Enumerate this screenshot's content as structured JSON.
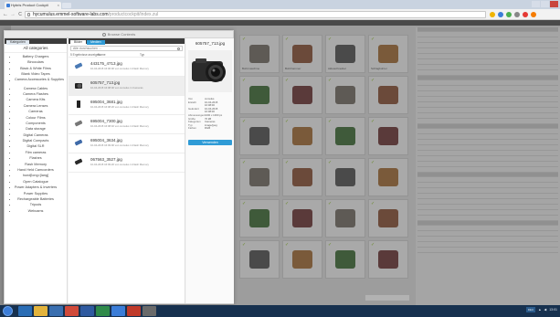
{
  "browser": {
    "tab_title": "Hybris Product Cockpit",
    "tab_close": "×",
    "url_host": "hycumulus.emmel-software-labs.com",
    "url_path": "/productcockpit/index.zul",
    "nav_back": "←",
    "nav_forward": "→",
    "nav_reload": "C"
  },
  "modal": {
    "title": "Browse Contents",
    "categories": {
      "tab_label": "Kategorien",
      "heading": "All categories",
      "items": [
        "Battery Chargers",
        "Binoculars",
        "Black & White Films",
        "Blank Video Tapes",
        "Camera Accessories & Supplies",
        "Camera Cables",
        "Camera Flashes",
        "Camera Kits",
        "Camera Lenses",
        "Cameras",
        "Colour Films",
        "Components",
        "Data storage",
        "Digital Cameras",
        "Digital Compacts",
        "Digital SLR",
        "Film cameras",
        "Flashes",
        "Flash Memory",
        "Hand Held Camcorders",
        "hund[long=]lang]",
        "Open Catalogue",
        "Power Adapters & Inverters",
        "Power Supplies",
        "Rechargeable Batteries",
        "Tripods",
        "Webcams"
      ]
    },
    "files": {
      "tab_active": "Bilder",
      "tab_inactive": "Medien",
      "search_placeholder": "Alle durchsuchen ...",
      "list_header_count": "5 Ergebnisse anzeigen",
      "list_header_name": "Name",
      "list_header_type": "Typ",
      "rows": [
        {
          "name": "443175_4713.jpg",
          "meta": "10-04-2015 16:06:00 von cumulus in Flash Memory"
        },
        {
          "name": "605757_713.jpg",
          "meta": "10-04-2015 16:08:00 von cumulus in Cameras"
        },
        {
          "name": "695004_3681.jpg",
          "meta": "10-04-2015 16:08:20 von cumulus in Flash Memory"
        },
        {
          "name": "695004_7300.jpg",
          "meta": "10-04-2015 16:08:40 von cumulus in Flash Memory"
        },
        {
          "name": "695004_3634.jpg",
          "meta": "10-04-2015 16:09:00 von cumulus in Flash Memory"
        },
        {
          "name": "067563_3527.jpg",
          "meta": "10-04-2015 16:09:20 von cumulus in Flash Memory"
        }
      ]
    },
    "details": {
      "title": "605757_713.jpg",
      "meta": [
        {
          "k": "Von",
          "v": "cumulus"
        },
        {
          "k": "Erstellt",
          "v": "10-04-2015"
        },
        {
          "k": "",
          "v": "16:08:00"
        },
        {
          "k": "Geändert",
          "v": "10-04-2015"
        },
        {
          "k": "",
          "v": "16:08:00"
        },
        {
          "k": "Abmessungen",
          "v": "1000 x 1000 px"
        },
        {
          "k": "Größe",
          "v": "70 kB"
        },
        {
          "k": "Kategorien",
          "v": "Cameras"
        },
        {
          "k": "Typ",
          "v": "image/jpeg"
        },
        {
          "k": "Farben",
          "v": "RGB"
        }
      ],
      "use_button": "Verwenden"
    }
  },
  "background": {
    "cell_captions": [
      "Bohrmaschine",
      "Bohrhammer",
      "Akkuschrauber",
      "Schlagbohrer"
    ]
  },
  "taskbar": {
    "lang": "DEU",
    "clock": "13:01"
  },
  "colors": {
    "accent": "#2f9bd6",
    "taskbar": "#17314f",
    "tab_bar": "#3c3c3c"
  }
}
